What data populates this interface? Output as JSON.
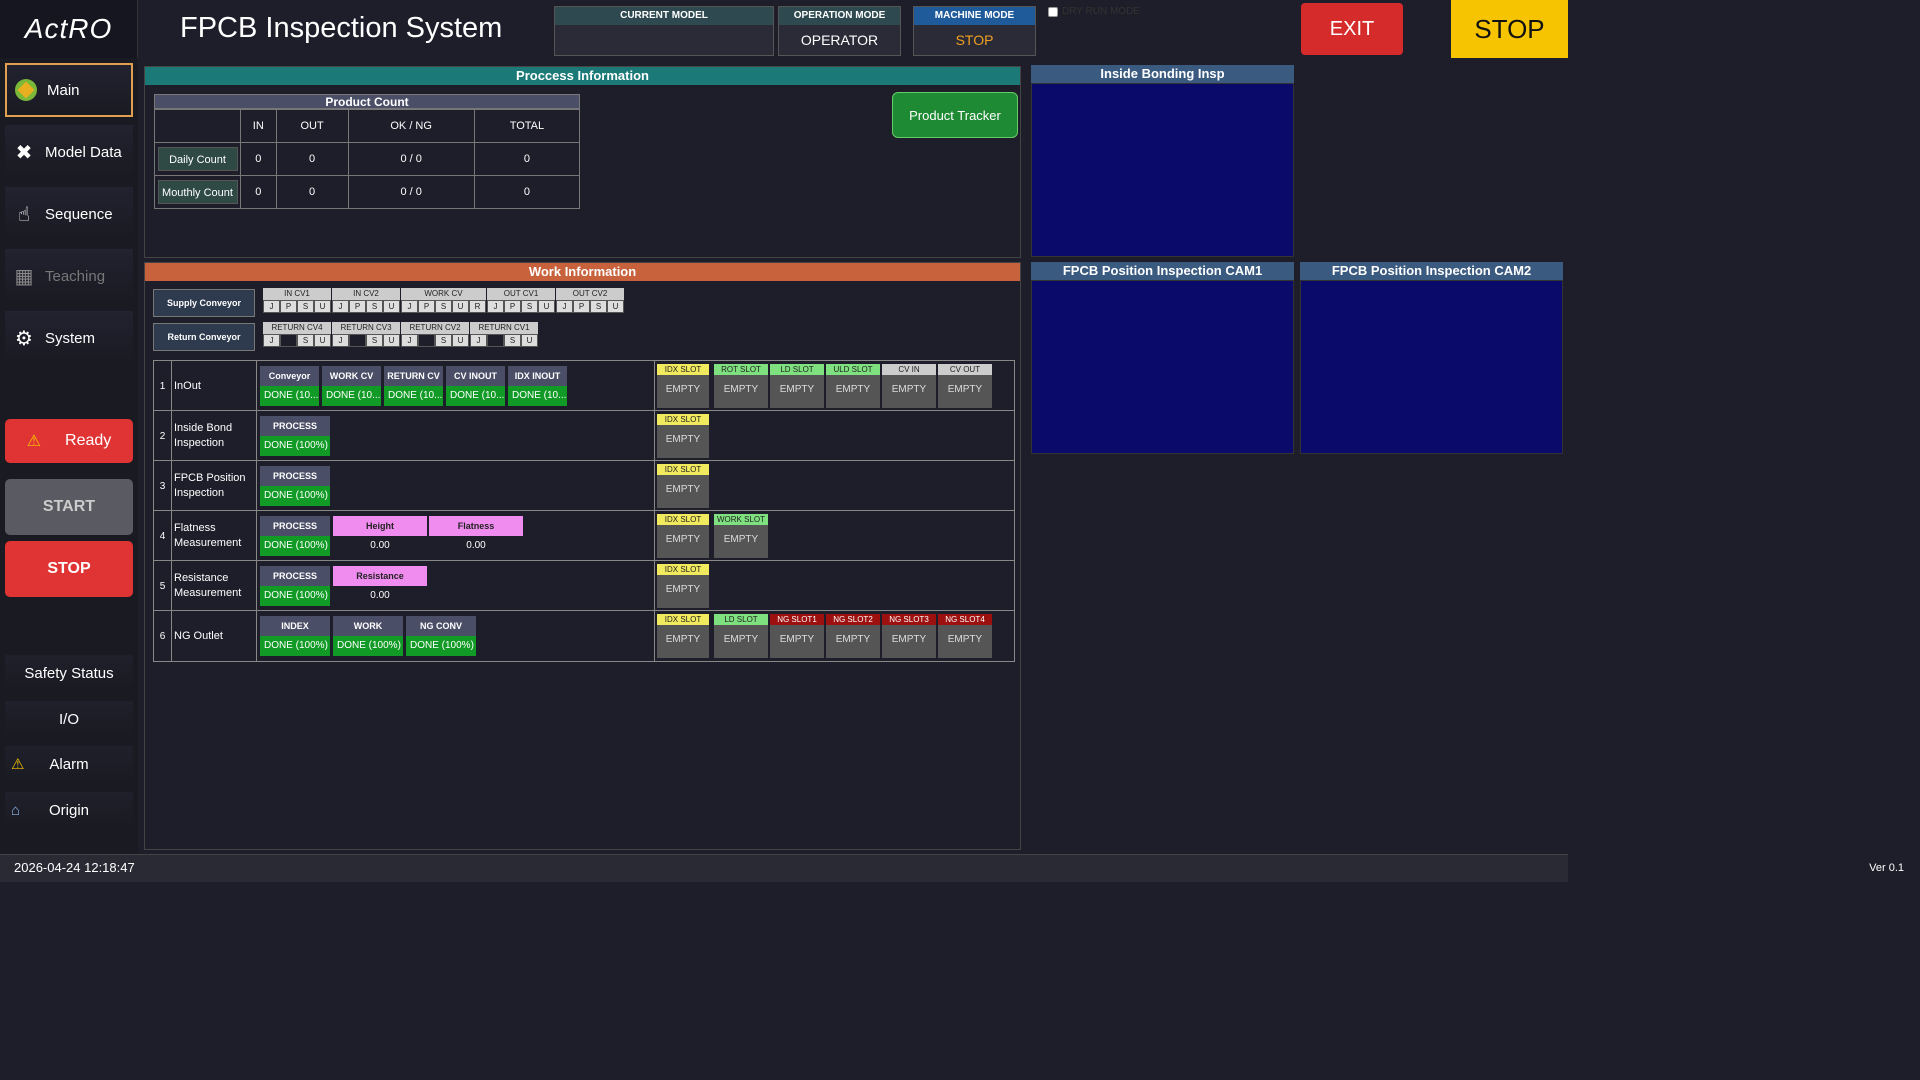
{
  "header": {
    "logo": "ActRO",
    "title": "FPCB Inspection System",
    "current_model_label": "CURRENT MODEL",
    "current_model_value": "",
    "operation_mode_label": "OPERATION MODE",
    "operation_mode_value": "OPERATOR",
    "machine_mode_label": "MACHINE MODE",
    "machine_mode_value": "STOP",
    "dry_run_label": "DRY RUN MODE",
    "exit_label": "EXIT",
    "stop_label": "STOP",
    "colors": {
      "exit": "#d62b2b",
      "stop": "#f6c400",
      "machine_stop": "#f0a020"
    }
  },
  "sidebar": {
    "main": "Main",
    "model_data": "Model Data",
    "sequence": "Sequence",
    "teaching": "Teaching",
    "system": "System",
    "ready": "Ready",
    "start": "START",
    "stop": "STOP",
    "safety": "Safety Status",
    "io": "I/O",
    "alarm": "Alarm",
    "origin": "Origin"
  },
  "process": {
    "title": "Proccess Information",
    "product_count": "Product Count",
    "cols": [
      "IN",
      "OUT",
      "OK / NG",
      "TOTAL"
    ],
    "rows": [
      {
        "label": "Daily Count",
        "vals": [
          "0",
          "0",
          "0 / 0",
          "0"
        ]
      },
      {
        "label": "Mouthly Count",
        "vals": [
          "0",
          "0",
          "0 / 0",
          "0"
        ]
      }
    ],
    "tracker": "Product Tracker"
  },
  "work": {
    "title": "Work Information",
    "supply": "Supply Conveyor",
    "return": "Return Conveyor",
    "supply_groups": [
      {
        "name": "IN CV1",
        "cells": [
          "J",
          "P",
          "S",
          "U"
        ]
      },
      {
        "name": "IN CV2",
        "cells": [
          "J",
          "P",
          "S",
          "U"
        ]
      },
      {
        "name": "WORK CV",
        "cells": [
          "J",
          "P",
          "S",
          "U",
          "R"
        ]
      },
      {
        "name": "OUT CV1",
        "cells": [
          "J",
          "P",
          "S",
          "U"
        ]
      },
      {
        "name": "OUT CV2",
        "cells": [
          "J",
          "P",
          "S",
          "U"
        ]
      }
    ],
    "return_groups": [
      {
        "name": "RETURN CV4",
        "cells": [
          "J",
          "",
          "S",
          "U"
        ]
      },
      {
        "name": "RETURN CV3",
        "cells": [
          "J",
          "",
          "S",
          "U"
        ]
      },
      {
        "name": "RETURN CV2",
        "cells": [
          "J",
          "",
          "S",
          "U"
        ]
      },
      {
        "name": "RETURN CV1",
        "cells": [
          "J",
          "",
          "S",
          "U"
        ]
      }
    ],
    "rows": [
      {
        "num": "1",
        "name": "InOut",
        "procs": [
          {
            "h": "Conveyor",
            "v": "DONE (10..."
          },
          {
            "h": "WORK CV",
            "v": "DONE (10..."
          },
          {
            "h": "RETURN CV",
            "v": "DONE (10..."
          },
          {
            "h": "CV INOUT",
            "v": "DONE (10..."
          },
          {
            "h": "IDX INOUT",
            "v": "DONE (10..."
          }
        ],
        "meas": [],
        "idx": {
          "h": "IDX SLOT",
          "v": "EMPTY"
        },
        "slots": [
          {
            "h": "ROT SLOT",
            "v": "EMPTY",
            "c": "grn"
          },
          {
            "h": "LD SLOT",
            "v": "EMPTY",
            "c": "grn"
          },
          {
            "h": "ULD SLOT",
            "v": "EMPTY",
            "c": "grn"
          },
          {
            "h": "CV IN",
            "v": "EMPTY",
            "c": "gry"
          },
          {
            "h": "CV OUT",
            "v": "EMPTY",
            "c": "gry"
          }
        ]
      },
      {
        "num": "2",
        "name": "Inside Bond Inspection",
        "procs": [
          {
            "h": "PROCESS",
            "v": "DONE (100%)"
          }
        ],
        "meas": [],
        "idx": {
          "h": "IDX SLOT",
          "v": "EMPTY"
        },
        "slots": []
      },
      {
        "num": "3",
        "name": "FPCB Position Inspection",
        "procs": [
          {
            "h": "PROCESS",
            "v": "DONE (100%)"
          }
        ],
        "meas": [],
        "idx": {
          "h": "IDX SLOT",
          "v": "EMPTY"
        },
        "slots": []
      },
      {
        "num": "4",
        "name": "Flatness Measurement",
        "procs": [
          {
            "h": "PROCESS",
            "v": "DONE (100%)"
          }
        ],
        "meas": [
          {
            "h": "Height",
            "v": "0.00"
          },
          {
            "h": "Flatness",
            "v": "0.00"
          }
        ],
        "idx": {
          "h": "IDX SLOT",
          "v": "EMPTY"
        },
        "slots": [
          {
            "h": "WORK SLOT",
            "v": "EMPTY",
            "c": "grn"
          }
        ]
      },
      {
        "num": "5",
        "name": "Resistance Measurement",
        "procs": [
          {
            "h": "PROCESS",
            "v": "DONE (100%)"
          }
        ],
        "meas": [
          {
            "h": "Resistance",
            "v": "0.00"
          }
        ],
        "idx": {
          "h": "IDX SLOT",
          "v": "EMPTY"
        },
        "slots": []
      },
      {
        "num": "6",
        "name": "NG Outlet",
        "procs": [
          {
            "h": "INDEX",
            "v": "DONE (100%)"
          },
          {
            "h": "WORK",
            "v": "DONE (100%)"
          },
          {
            "h": "NG CONV",
            "v": "DONE (100%)"
          }
        ],
        "meas": [],
        "idx": {
          "h": "IDX SLOT",
          "v": "EMPTY"
        },
        "slots": [
          {
            "h": "LD SLOT",
            "v": "EMPTY",
            "c": "grn"
          },
          {
            "h": "NG SLOT1",
            "v": "EMPTY",
            "c": "red"
          },
          {
            "h": "NG SLOT2",
            "v": "EMPTY",
            "c": "red"
          },
          {
            "h": "NG SLOT3",
            "v": "EMPTY",
            "c": "red"
          },
          {
            "h": "NG SLOT4",
            "v": "EMPTY",
            "c": "red"
          }
        ]
      }
    ]
  },
  "cams": {
    "inside": "Inside Bonding Insp",
    "cam1": "FPCB Position Inspection CAM1",
    "cam2": "FPCB Position Inspection CAM2"
  },
  "status": {
    "datetime": "2026-04-24 12:18:47",
    "version": "Ver 0.1"
  }
}
